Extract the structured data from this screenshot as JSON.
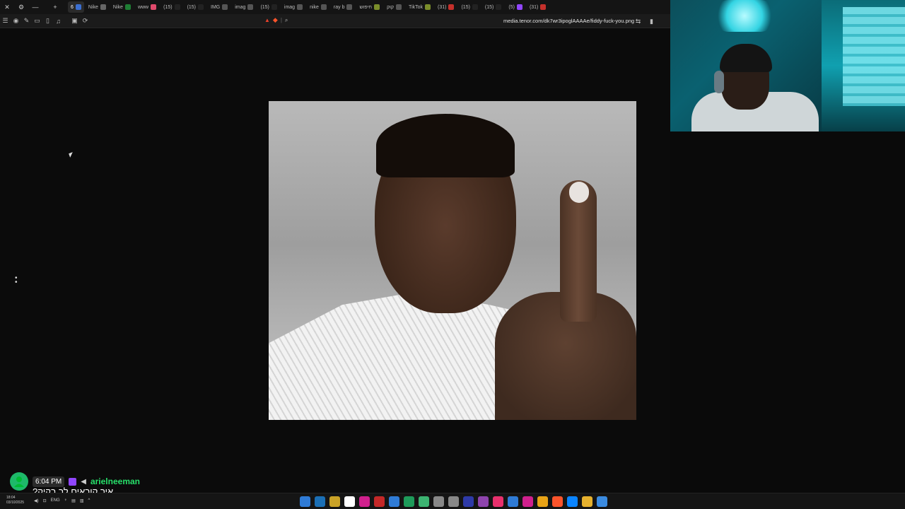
{
  "browser": {
    "tabs": [
      {
        "label": "6",
        "color": "#3b6fd1",
        "active": true
      },
      {
        "label": "Nike",
        "color": "#666"
      },
      {
        "label": "Nike",
        "color": "#1e7e34"
      },
      {
        "label": "www",
        "color": "#e04a6c"
      },
      {
        "label": "(15)",
        "color": "#222"
      },
      {
        "label": "(15)",
        "color": "#222"
      },
      {
        "label": "IMG",
        "color": "#555"
      },
      {
        "label": "imag",
        "color": "#555"
      },
      {
        "label": "(15)",
        "color": "#222"
      },
      {
        "label": "imag",
        "color": "#555"
      },
      {
        "label": "nike",
        "color": "#555"
      },
      {
        "label": "ray b",
        "color": "#555"
      },
      {
        "label": "חיפוש",
        "color": "#7a8d2a"
      },
      {
        "label": "קוק",
        "color": "#555"
      },
      {
        "label": "TikTok",
        "color": "#7a8d2a"
      },
      {
        "label": "(31)",
        "color": "#c4302b"
      },
      {
        "label": "(15)",
        "color": "#222"
      },
      {
        "label": "(15)",
        "color": "#222"
      },
      {
        "label": "(5)",
        "color": "#9146ff"
      },
      {
        "label": "(31)",
        "color": "#c4302b"
      }
    ],
    "url": "media.tenor.com/dk7wr3ipoglAAAAe/fiddy-fuck-you.png"
  },
  "chat": {
    "time": "6:04 PM",
    "username": "arielneeman",
    "message": "איך קוראים לך בקיק?"
  },
  "taskbar": {
    "time": "18:04",
    "date": "03/10/2025",
    "lang": "ENG",
    "apps": [
      "#2f7bd6",
      "#1b6fb5",
      "#c9a227",
      "#ffffff",
      "#d0208d",
      "#c42828",
      "#2f7bd6",
      "#1e9b5a",
      "#3cb371",
      "#888888",
      "#888888",
      "#2e3aa8",
      "#8e44ad",
      "#e8306d",
      "#2f7bd6",
      "#d0208d",
      "#e8a317",
      "#fb542b",
      "#0a84ff",
      "#e6b12e",
      "#3b8be0"
    ]
  }
}
